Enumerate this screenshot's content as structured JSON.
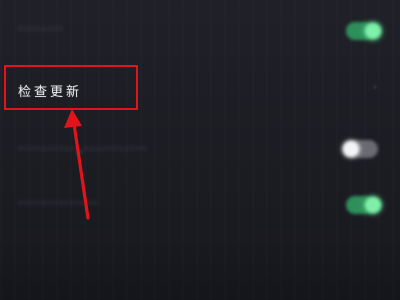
{
  "settings": {
    "items": [
      {
        "label": "········",
        "toggle": "on"
      },
      {
        "label": "检查更新",
        "has_chevron": true
      },
      {
        "label": "··········，···········",
        "toggle": "off"
      },
      {
        "label": "··············",
        "toggle": "on"
      }
    ]
  },
  "annotation": {
    "highlight_color": "#e0141a"
  },
  "icons": {
    "chevron": "chevron-right-icon"
  },
  "colors": {
    "background": "#1b1c22",
    "toggle_on": "#2e8f5a",
    "toggle_off": "#6a6b72"
  }
}
